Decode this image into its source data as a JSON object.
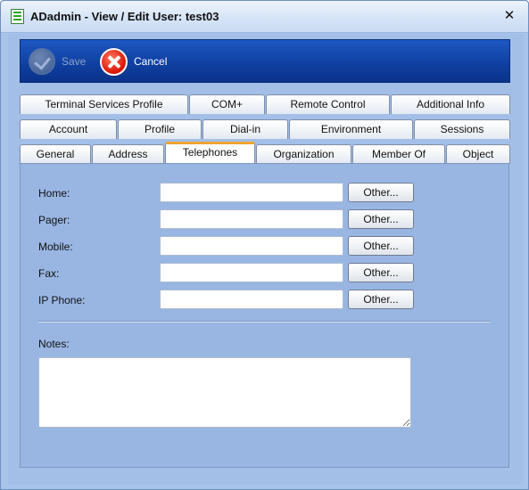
{
  "window": {
    "title": "ADadmin - View / Edit User:  test03",
    "close_glyph": "✕",
    "icon": "app-form-icon"
  },
  "toolbar": {
    "save_label": "Save",
    "save_icon": "checkmark-circle-icon",
    "cancel_label": "Cancel",
    "cancel_icon": "red-x-circle-icon"
  },
  "tabs": {
    "row1": [
      "Terminal Services Profile",
      "COM+",
      "Remote Control",
      "Additional Info"
    ],
    "row2": [
      "Account",
      "Profile",
      "Dial-in",
      "Environment",
      "Sessions"
    ],
    "row3": [
      "General",
      "Address",
      "Telephones",
      "Organization",
      "Member Of",
      "Object"
    ],
    "active": "Telephones"
  },
  "telephones": {
    "fields": [
      {
        "label": "Home:",
        "value": "",
        "button": "Other..."
      },
      {
        "label": "Pager:",
        "value": "",
        "button": "Other..."
      },
      {
        "label": "Mobile:",
        "value": "",
        "button": "Other..."
      },
      {
        "label": "Fax:",
        "value": "",
        "button": "Other..."
      },
      {
        "label": "IP Phone:",
        "value": "",
        "button": "Other..."
      }
    ],
    "notes_label": "Notes:",
    "notes_value": ""
  },
  "colors": {
    "toolbar": "#1446a8",
    "background": "#a3bfe8",
    "active_tab_accent": "#f0a431"
  }
}
